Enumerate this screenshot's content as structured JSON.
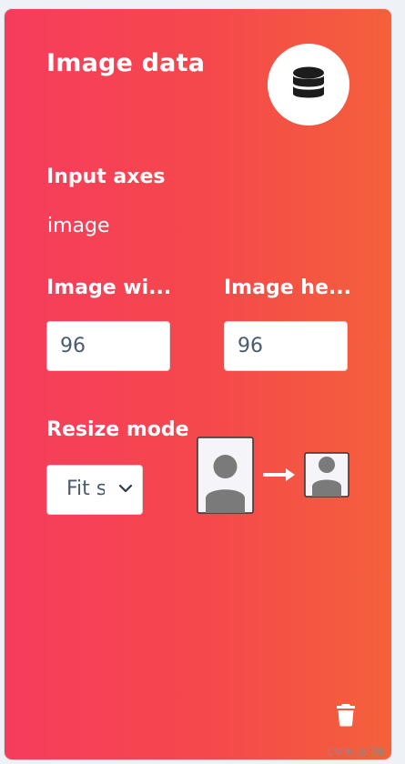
{
  "card": {
    "title": "Image data",
    "header_icon": "database-icon",
    "delete_icon": "trash-icon",
    "colors": {
      "gradient_start": "#f63c5d",
      "gradient_end": "#f4613a",
      "text": "#ffffff",
      "input_text": "#4a5a70"
    }
  },
  "input_axes": {
    "label": "Input axes",
    "value": "image"
  },
  "image_width": {
    "label": "Image wi...",
    "value": "96"
  },
  "image_height": {
    "label": "Image he...",
    "value": "96"
  },
  "resize_mode": {
    "label": "Resize mode",
    "selected": "Fit s",
    "illustration_icons": [
      "portrait-tall-icon",
      "arrow-right-icon",
      "portrait-square-icon"
    ]
  },
  "watermark": "CSDN @自除"
}
